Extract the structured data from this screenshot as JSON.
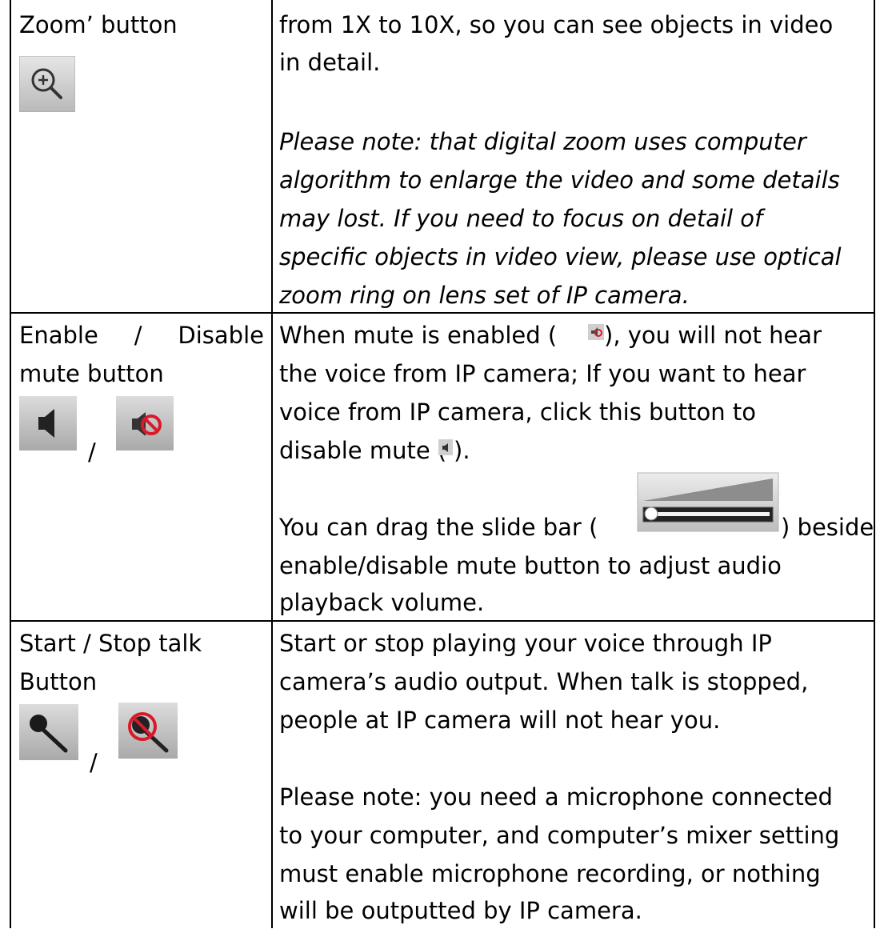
{
  "rows": {
    "zoom": {
      "label_line1": "Zoom’ button",
      "desc_line1": "from 1X to 10X, so you can see objects in video",
      "desc_line2": "in detail.",
      "note_line1": "Please note: that digital zoom uses computer",
      "note_line2": "algorithm to enlarge the video and some details",
      "note_line3": "may lost. If you need to focus on detail of",
      "note_line4": "specific objects in video view, please use optical",
      "note_line5": "zoom ring on lens set of IP camera.",
      "icon": "zoom-in-icon"
    },
    "mute": {
      "label_word1": "Enable",
      "label_word2": "/",
      "label_word3": "Disable",
      "label_line2": "mute button",
      "icon_separator": "/",
      "desc_line1_a": "When mute is enabled (",
      "desc_line1_b": "), you will not hear",
      "desc_line2": "the voice from IP camera; If you want to hear",
      "desc_line3": "voice from IP camera, click this button to",
      "desc_line4_a": "disable mute (",
      "desc_line4_b": ").",
      "slide_line1_a": "You can drag the slide bar (",
      "slide_line1_b": ") beside",
      "slide_line2": "enable/disable mute button to adjust audio",
      "slide_line3": "playback volume.",
      "icons": [
        "speaker-icon",
        "muted-speaker-icon",
        "volume-slider-icon"
      ]
    },
    "talk": {
      "label_line1": "Start / Stop talk",
      "label_line2": "Button",
      "icon_separator": "/",
      "desc_line1": "Start or stop playing your voice through IP",
      "desc_line2": "camera’s audio output. When talk is stopped,",
      "desc_line3": "people at IP camera will not hear you.",
      "note_line1": "Please note: you need a microphone connected",
      "note_line2": "to your computer, and computer’s mixer setting",
      "note_line3": "must enable microphone recording, or nothing",
      "note_line4": "will be outputted by IP camera.",
      "icons": [
        "microphone-icon",
        "muted-microphone-icon"
      ]
    }
  }
}
